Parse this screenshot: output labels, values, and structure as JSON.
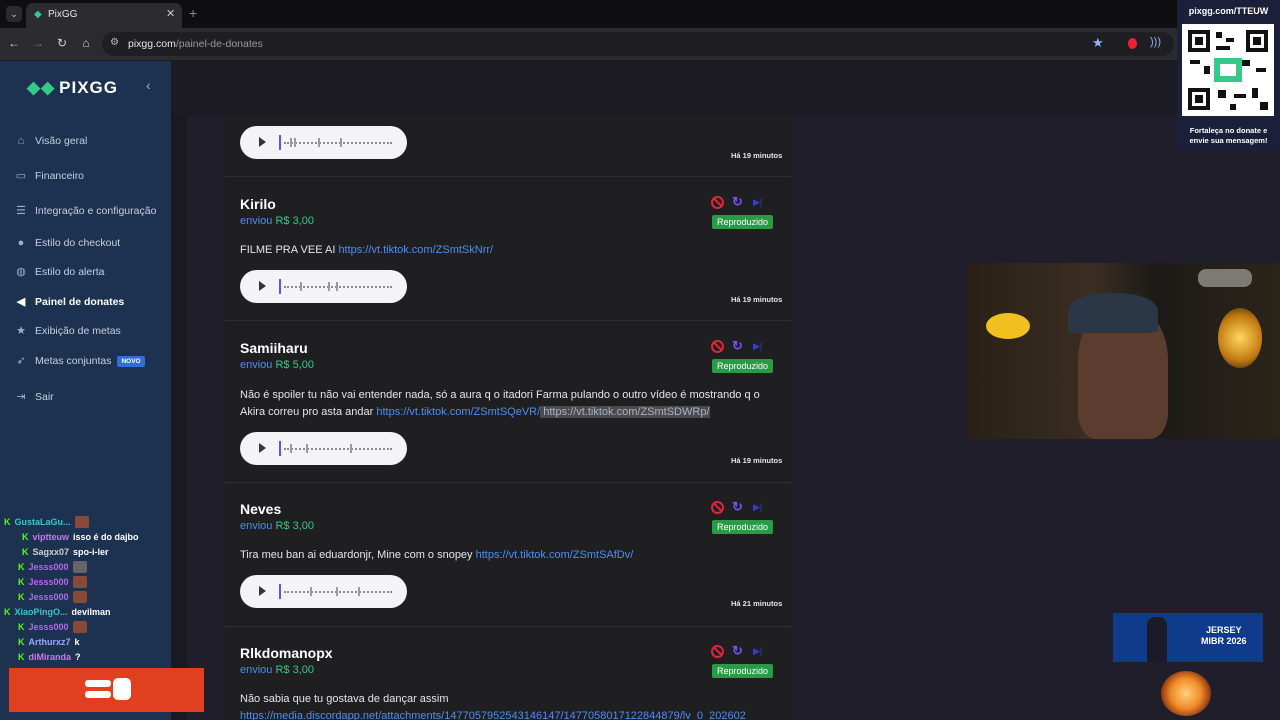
{
  "browser": {
    "tab_title": "PixGG",
    "url_host": "pixgg.com",
    "url_path": "/painel-de-donates"
  },
  "sidebar": {
    "logo": "PIXGG",
    "items": [
      {
        "label": "Visão geral",
        "icon": "home-icon"
      },
      {
        "label": "Financeiro",
        "icon": "wallet-icon"
      },
      {
        "label": "Integração e configuração",
        "icon": "list-icon"
      },
      {
        "label": "Estilo do checkout",
        "icon": "palette-icon"
      },
      {
        "label": "Estilo do alerta",
        "icon": "palette-icon"
      },
      {
        "label": "Painel de donates",
        "icon": "megaphone-icon"
      },
      {
        "label": "Exibição de metas",
        "icon": "star-icon"
      },
      {
        "label": "Metas conjuntas",
        "icon": "rocket-icon",
        "badge": "NOVO"
      },
      {
        "label": "Sair",
        "icon": "logout-icon"
      }
    ]
  },
  "chat": [
    {
      "user": "GustaLaGu...",
      "color": "#36c9c9",
      "msg": ""
    },
    {
      "user": "viptteuw",
      "color": "#c878f0",
      "msg": "isso é do dajbo"
    },
    {
      "user": "Sagxx07",
      "color": "#d0d0d0",
      "msg": "spo-i-ler"
    },
    {
      "user": "Jesss000",
      "color": "#b468f0",
      "msg": ""
    },
    {
      "user": "Jesss000",
      "color": "#b468f0",
      "msg": ""
    },
    {
      "user": "Jesss000",
      "color": "#b468f0",
      "msg": ""
    },
    {
      "user": "XiaoPingO...",
      "color": "#36c9c9",
      "msg": "devilman"
    },
    {
      "user": "Jesss000",
      "color": "#b468f0",
      "msg": ""
    },
    {
      "user": "Arthurxz7",
      "color": "#9aa8ff",
      "msg": "k"
    },
    {
      "user": "diMiranda",
      "color": "#c878f0",
      "msg": "?"
    }
  ],
  "feed": {
    "sent_label": "enviou",
    "status_label": "Reproduzido",
    "cards": [
      {
        "time": "Há 19 minutos"
      },
      {
        "name": "Kirilo",
        "amount": "R$ 3,00",
        "text": "FILME PRA VEE AI ",
        "link": "https://vt.tiktok.com/ZSmtSkNrr/",
        "time": "Há 19 minutos"
      },
      {
        "name": "Samiiharu",
        "amount": "R$ 5,00",
        "text": "Não é spoiler tu não vai entender nada, só a aura q o itadori Farma pulando o outro vídeo é mostrando q o Akira correu pro asta andar ",
        "link": "https://vt.tiktok.com/ZSmtSQeVR/",
        "link2": " https://vt.tiktok.com/ZSmtSDWRp/",
        "time": "Há 19 minutos"
      },
      {
        "name": "Neves",
        "amount": "R$ 3,00",
        "text": "Tira meu ban ai eduardonjr, Mine com o snopey ",
        "link": "https://vt.tiktok.com/ZSmtSAfDv/",
        "time": "Há 21 minutos"
      },
      {
        "name": "Rlkdomanopx",
        "amount": "R$ 3,00",
        "text": "Não sabia que tu gostava de dançar assim",
        "link": "https://media.discordapp.net/attachments/1477057952543146147/1477058017122844879/lv_0_202602"
      }
    ]
  },
  "overlay": {
    "qr_url": "pixgg.com/TTEUW",
    "qr_caption": "Fortaleça no donate e envie sua mensagem!",
    "promo_text_1": "JERSEY",
    "promo_text_2": "MIBR 2026"
  }
}
